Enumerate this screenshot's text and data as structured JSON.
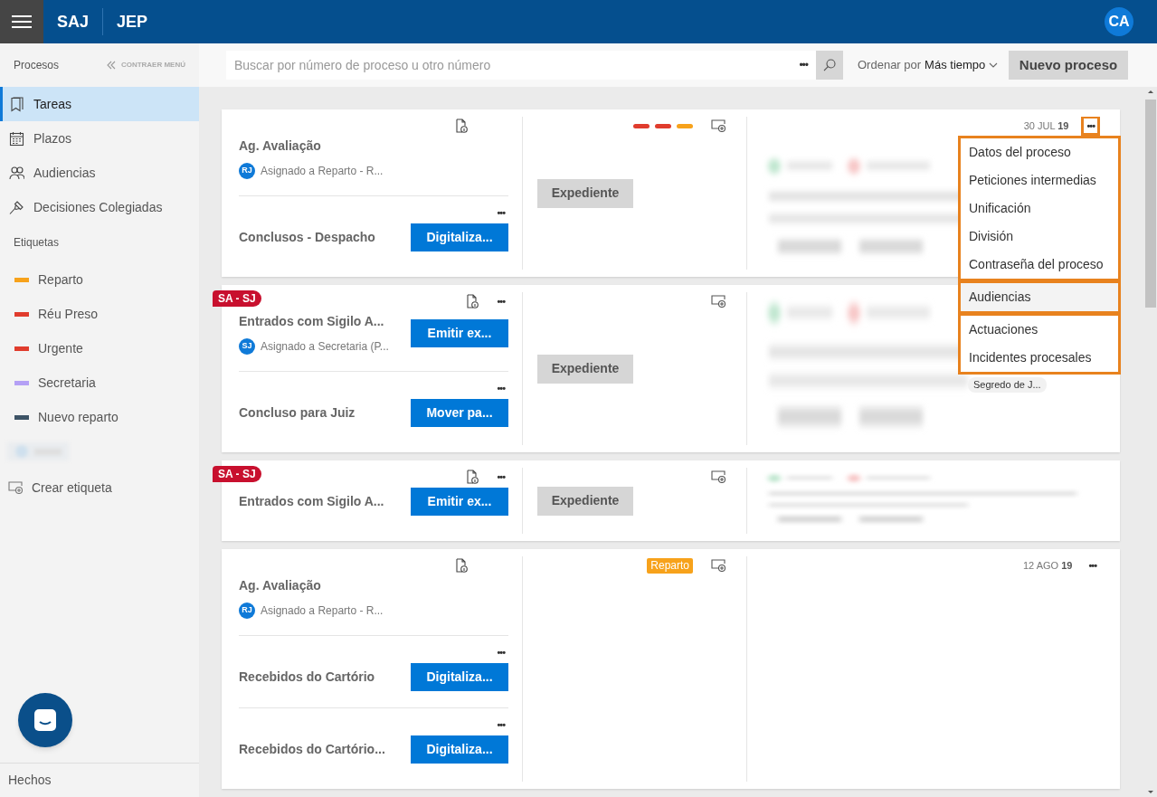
{
  "header": {
    "brand": "SAJ",
    "product": "JEP",
    "avatar": "CA"
  },
  "sidebar": {
    "title": "Procesos",
    "collapse": "CONTRAER MENÚ",
    "items": [
      {
        "label": "Tareas",
        "selected": true
      },
      {
        "label": "Plazos",
        "selected": false
      },
      {
        "label": "Audiencias",
        "selected": false
      },
      {
        "label": "Decisiones Colegiadas",
        "selected": false
      }
    ],
    "labels_title": "Etiquetas",
    "labels": [
      {
        "label": "Reparto",
        "color": "#f7a21b"
      },
      {
        "label": "Réu Preso",
        "color": "#e03c2d"
      },
      {
        "label": "Urgente",
        "color": "#e03c2d"
      },
      {
        "label": "Secretaria",
        "color": "#b4a0f5"
      },
      {
        "label": "Nuevo reparto",
        "color": "#3d5366"
      },
      {
        "kind": "blurred"
      }
    ],
    "create_label": "Crear etiqueta",
    "footer": "Hechos"
  },
  "toolbar": {
    "search_placeholder": "Buscar por número de proceso u otro número",
    "more": "•••",
    "sort_label": "Ordenar por",
    "sort_value": "Más tiempo",
    "new_button": "Nuevo proceso"
  },
  "cards": [
    {
      "tasks": [
        {
          "title": "Ag. Avaliação",
          "assignee_initials": "RJ",
          "assignee": "Asignado a Reparto - R...",
          "doc_icon": true
        },
        {
          "title": "Conclusos - Despacho",
          "doc_icon": false,
          "more": "•••",
          "button": "Digitaliza..."
        }
      ],
      "label_bars": [
        {
          "color": "#e03c2d"
        },
        {
          "color": "#e03c2d"
        },
        {
          "color": "#f7a21b"
        }
      ],
      "expediente": "Expediente",
      "date": "30 JUL",
      "year": "19",
      "more": "•••",
      "more_active": true,
      "blurred": true
    },
    {
      "tag": "SA - SJ",
      "tasks": [
        {
          "title": "Entrados com Sigilo A...",
          "assignee_initials": "SJ",
          "assignee": "Asignado a Secretaria (P...",
          "doc_icon": true,
          "more": "•••",
          "button": "Emitir ex..."
        },
        {
          "title": "Concluso para Juiz",
          "doc_icon": false,
          "more": "•••",
          "button": "Mover pa..."
        }
      ],
      "expediente": "Expediente",
      "blurred": true,
      "chip": "Segredo de J..."
    },
    {
      "tag": "SA - SJ",
      "tasks": [
        {
          "title": "Entrados com Sigilo A...",
          "doc_icon": true,
          "more": "•••",
          "button": "Emitir ex..."
        }
      ],
      "expediente": "Expediente",
      "blurred": true
    },
    {
      "tasks": [
        {
          "title": "Ag. Avaliação",
          "assignee_initials": "RJ",
          "assignee": "Asignado a Reparto - R...",
          "doc_icon": true
        },
        {
          "title": "Recebidos do Cartório",
          "doc_icon": false,
          "more": "•••",
          "button": "Digitaliza..."
        },
        {
          "title": "Recebidos do Cartório...",
          "doc_icon": false,
          "more": "•••",
          "button": "Digitaliza..."
        }
      ],
      "label_badge": {
        "label": "Reparto",
        "color": "#f7a21b"
      },
      "date": "12 AGO",
      "year": "19",
      "more": "•••",
      "more_active": false
    }
  ],
  "menu": {
    "groups": [
      [
        {
          "label": "Datos del proceso",
          "highlighted": false
        },
        {
          "label": "Peticiones intermedias",
          "highlighted": false
        },
        {
          "label": "Unificación",
          "highlighted": false
        },
        {
          "label": "División",
          "highlighted": false
        },
        {
          "label": "Contraseña del proceso",
          "highlighted": false
        }
      ],
      [
        {
          "label": "Audiencias",
          "highlighted": true
        }
      ],
      [
        {
          "label": "Actuaciones",
          "highlighted": false
        },
        {
          "label": "Incidentes procesales",
          "highlighted": false
        }
      ]
    ]
  }
}
